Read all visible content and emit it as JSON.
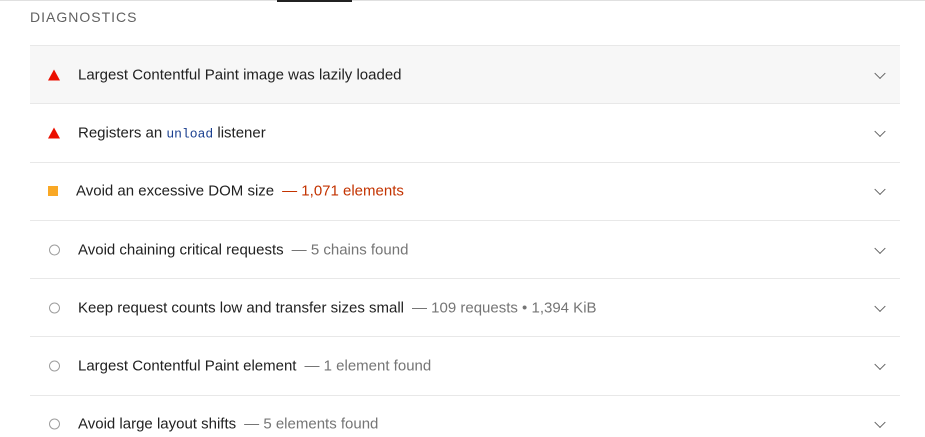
{
  "section": {
    "title": "DIAGNOSTICS"
  },
  "audits": [
    {
      "status": "fail",
      "title": "Largest Contentful Paint image was lazily loaded",
      "display": ""
    },
    {
      "status": "fail",
      "title_pre": "Registers an ",
      "title_code": "unload",
      "title_post": " listener",
      "display": ""
    },
    {
      "status": "average",
      "title": "Avoid an excessive DOM size",
      "display": "— 1,071 elements"
    },
    {
      "status": "info",
      "title": "Avoid chaining critical requests",
      "display": "— 5 chains found"
    },
    {
      "status": "info",
      "title": "Keep request counts low and transfer sizes small",
      "display": "— 109 requests • 1,394 KiB"
    },
    {
      "status": "info",
      "title": "Largest Contentful Paint element",
      "display": "— 1 element found"
    },
    {
      "status": "info",
      "title": "Avoid large layout shifts",
      "display": "— 5 elements found"
    }
  ],
  "colors": {
    "fail": "#eb0f00",
    "average": "#f9a825",
    "info": "#9e9e9e",
    "warn_text": "#c33300"
  },
  "icons": {
    "fail": "triangle-icon",
    "average": "square-icon",
    "info": "circle-icon",
    "expand": "chevron-down-icon"
  }
}
